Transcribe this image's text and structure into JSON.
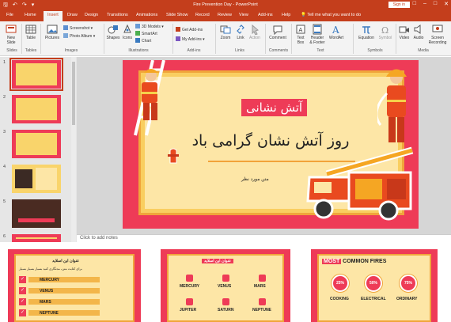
{
  "window": {
    "title": "Fire Prevention Day  -  PowerPoint",
    "sign_in": "Sign in",
    "quick_access": [
      "save-icon",
      "undo-icon",
      "redo-icon",
      "customize-icon"
    ],
    "controls": [
      "restore-ribbon-icon",
      "minimize-icon",
      "maximize-icon",
      "close-icon"
    ]
  },
  "tabs": [
    "File",
    "Home",
    "Insert",
    "Draw",
    "Design",
    "Transitions",
    "Animations",
    "Slide Show",
    "Record",
    "Review",
    "View",
    "Add-ins",
    "Help"
  ],
  "active_tab": "Insert",
  "tell_me": "Tell me what you want to do",
  "ribbon": {
    "new_slide": "New\nSlide",
    "table": "Table",
    "pictures": "Pictures",
    "screenshot": "Screenshot",
    "photo_album": "Photo Album",
    "shapes": "Shapes",
    "icons": "Icons",
    "models_3d": "3D Models",
    "smartart": "SmartArt",
    "chart": "Chart",
    "get_addins": "Get Add-ins",
    "my_addins": "My Add-ins",
    "zoom": "Zoom",
    "link": "Link",
    "action": "Action",
    "comment": "Comment",
    "text_box": "Text\nBox",
    "header_footer": "Header\n& Footer",
    "wordart": "WordArt",
    "equation": "Equation",
    "symbol": "Symbol",
    "video": "Video",
    "audio": "Audio",
    "screen_recording": "Screen\nRecording",
    "groups": [
      "Slides",
      "Tables",
      "Images",
      "Illustrations",
      "Add-ins",
      "Links",
      "Comments",
      "Text",
      "Symbols",
      "Media"
    ]
  },
  "thumbnails": [
    "1",
    "2",
    "3",
    "4",
    "5",
    "6"
  ],
  "slide": {
    "title": "آتش نشانی",
    "subtitle": "روز آتش نشان گرامی باد",
    "small_text": "متن مورد نظر",
    "accent": "#ee3b57",
    "card": "#f9ce60"
  },
  "notes_placeholder": "Click to add notes",
  "bottom_slides": {
    "left": {
      "title": "عنوان این اسلاید",
      "items": [
        "MERCURY",
        "VENUS",
        "MARS",
        "NEPTUNE"
      ],
      "desc": "برای کتابت متن، مدنگاری کنید بسیار بسیار بسیار"
    },
    "middle": {
      "title": "عنوان این اسلاید",
      "items": [
        "MERCURY",
        "VENUS",
        "MARS",
        "JUPITER",
        "SATURN",
        "NEPTUNE"
      ]
    },
    "right": {
      "title_highlight": "MOST",
      "title_rest": " COMMON FIRES",
      "stats": [
        {
          "value": "25%",
          "label": "COOKING"
        },
        {
          "value": "50%",
          "label": "ELECTRICAL"
        },
        {
          "value": "75%",
          "label": "ORDINARY"
        }
      ]
    }
  }
}
